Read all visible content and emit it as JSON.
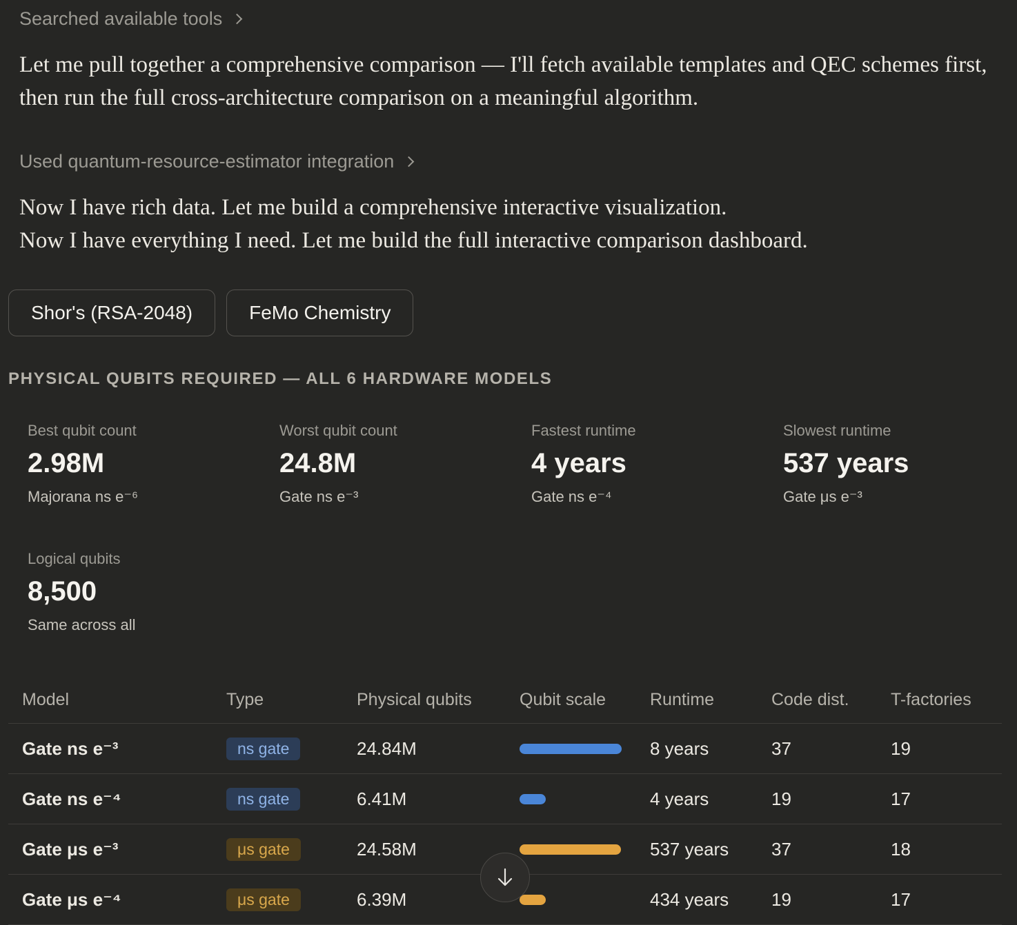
{
  "tool_calls": {
    "first": "Searched available tools",
    "second": "Used quantum-resource-estimator integration"
  },
  "messages": {
    "intro": "Let me pull together a comprehensive comparison — I'll fetch available templates and QEC schemes first, then run the full cross-architecture comparison on a meaningful algorithm.",
    "line1": "Now I have rich data. Let me build a comprehensive interactive visualization.",
    "line2": "Now I have everything I need. Let me build the full interactive comparison dashboard."
  },
  "algorithm_tabs": [
    {
      "label": "Shor's (RSA-2048)"
    },
    {
      "label": "FeMo Chemistry"
    }
  ],
  "section_title": "PHYSICAL QUBITS REQUIRED — ALL 6 HARDWARE MODELS",
  "metrics": [
    {
      "label": "Best qubit count",
      "value": "2.98M",
      "sub": "Majorana ns e⁻⁶"
    },
    {
      "label": "Worst qubit count",
      "value": "24.8M",
      "sub": "Gate ns e⁻³"
    },
    {
      "label": "Fastest runtime",
      "value": "4 years",
      "sub": "Gate ns e⁻⁴"
    },
    {
      "label": "Slowest runtime",
      "value": "537 years",
      "sub": "Gate μs e⁻³"
    },
    {
      "label": "Logical qubits",
      "value": "8,500",
      "sub": "Same across all"
    }
  ],
  "table": {
    "headers": {
      "model": "Model",
      "type": "Type",
      "physical": "Physical qubits",
      "scale": "Qubit scale",
      "runtime": "Runtime",
      "code_dist": "Code dist.",
      "t_factories": "T-factories"
    },
    "rows": [
      {
        "model": "Gate ns e⁻³",
        "type": "ns gate",
        "kind": "ns",
        "physical": "24.84M",
        "scale_fraction": 1.0,
        "runtime": "8 years",
        "code_dist": "37",
        "t_factories": "19"
      },
      {
        "model": "Gate ns e⁻⁴",
        "type": "ns gate",
        "kind": "ns",
        "physical": "6.41M",
        "scale_fraction": 0.26,
        "runtime": "4 years",
        "code_dist": "19",
        "t_factories": "17"
      },
      {
        "model": "Gate μs e⁻³",
        "type": "μs gate",
        "kind": "us",
        "physical": "24.58M",
        "scale_fraction": 0.99,
        "runtime": "537 years",
        "code_dist": "37",
        "t_factories": "18"
      },
      {
        "model": "Gate μs e⁻⁴",
        "type": "μs gate",
        "kind": "us",
        "physical": "6.39M",
        "scale_fraction": 0.26,
        "runtime": "434 years",
        "code_dist": "19",
        "t_factories": "17"
      }
    ]
  },
  "icons": {
    "tool_chevron": "chevron-right-icon",
    "scroll_down": "arrow-down-icon"
  },
  "colors": {
    "background": "#262624",
    "ns_accent": "#4a86d8",
    "us_accent": "#e4a440"
  }
}
